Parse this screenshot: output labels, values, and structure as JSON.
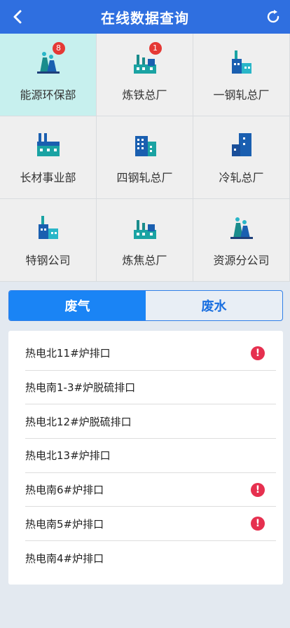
{
  "header": {
    "title": "在线数据查询"
  },
  "departments": [
    {
      "label": "能源环保部",
      "badge": "8",
      "icon": "power-plant-icon",
      "active": true
    },
    {
      "label": "炼铁总厂",
      "badge": "1",
      "icon": "factory-icon"
    },
    {
      "label": "一钢轧总厂",
      "icon": "factory-icon"
    },
    {
      "label": "长材事业部",
      "icon": "factory-building-icon"
    },
    {
      "label": "四钢轧总厂",
      "icon": "office-building-icon"
    },
    {
      "label": "冷轧总厂",
      "icon": "office-building-icon"
    },
    {
      "label": "特钢公司",
      "icon": "factory-icon"
    },
    {
      "label": "炼焦总厂",
      "icon": "factory-icon"
    },
    {
      "label": "资源分公司",
      "icon": "power-plant-icon"
    }
  ],
  "tabs": [
    {
      "label": "废气",
      "active": true
    },
    {
      "label": "废水",
      "active": false
    }
  ],
  "outlets": [
    {
      "name": "热电北11#炉排口",
      "alert": true
    },
    {
      "name": "热电南1-3#炉脱硫排口",
      "alert": false
    },
    {
      "name": "热电北12#炉脱硫排口",
      "alert": false
    },
    {
      "name": "热电北13#炉排口",
      "alert": false
    },
    {
      "name": "热电南6#炉排口",
      "alert": true
    },
    {
      "name": "热电南5#炉排口",
      "alert": true
    },
    {
      "name": "热电南4#炉排口",
      "alert": false
    }
  ],
  "alert_symbol": "!"
}
